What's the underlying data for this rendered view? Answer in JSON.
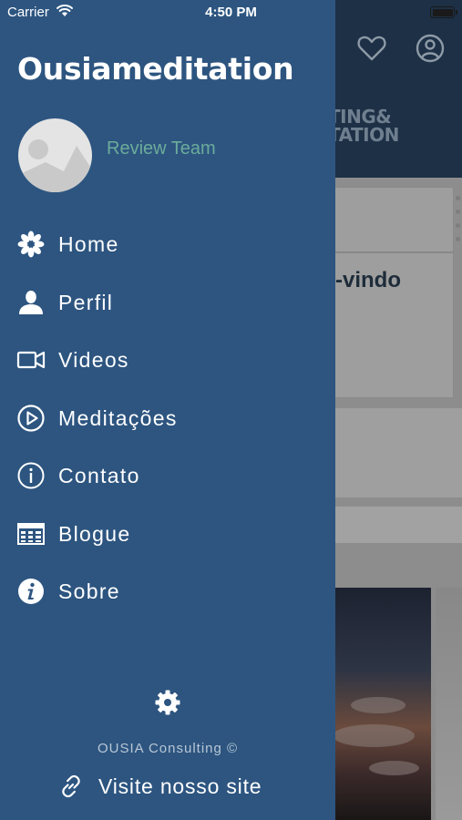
{
  "status_bar": {
    "carrier": "Carrier",
    "time": "4:50 PM"
  },
  "drawer": {
    "app_title": "Ousiameditation",
    "user_name": "Review Team",
    "menu": [
      {
        "label": "Home",
        "icon": "flower-icon"
      },
      {
        "label": "Perfil",
        "icon": "person-icon"
      },
      {
        "label": "Videos",
        "icon": "video-camera-icon"
      },
      {
        "label": "Meditações",
        "icon": "play-circle-icon"
      },
      {
        "label": "Contato",
        "icon": "info-circle-icon"
      },
      {
        "label": "Blogue",
        "icon": "table-icon"
      },
      {
        "label": "Sobre",
        "icon": "info-filled-icon"
      }
    ],
    "copyright": "OUSIA Consulting ©",
    "site_link": "Visite nosso site"
  },
  "background_app": {
    "logo_line1": "TING&",
    "logo_line2": "TATION",
    "welcome_fragment": "-vindo"
  },
  "colors": {
    "drawer_bg": "#2d5580",
    "user_name": "#6cab9b",
    "header_bg": "#1d3046"
  }
}
